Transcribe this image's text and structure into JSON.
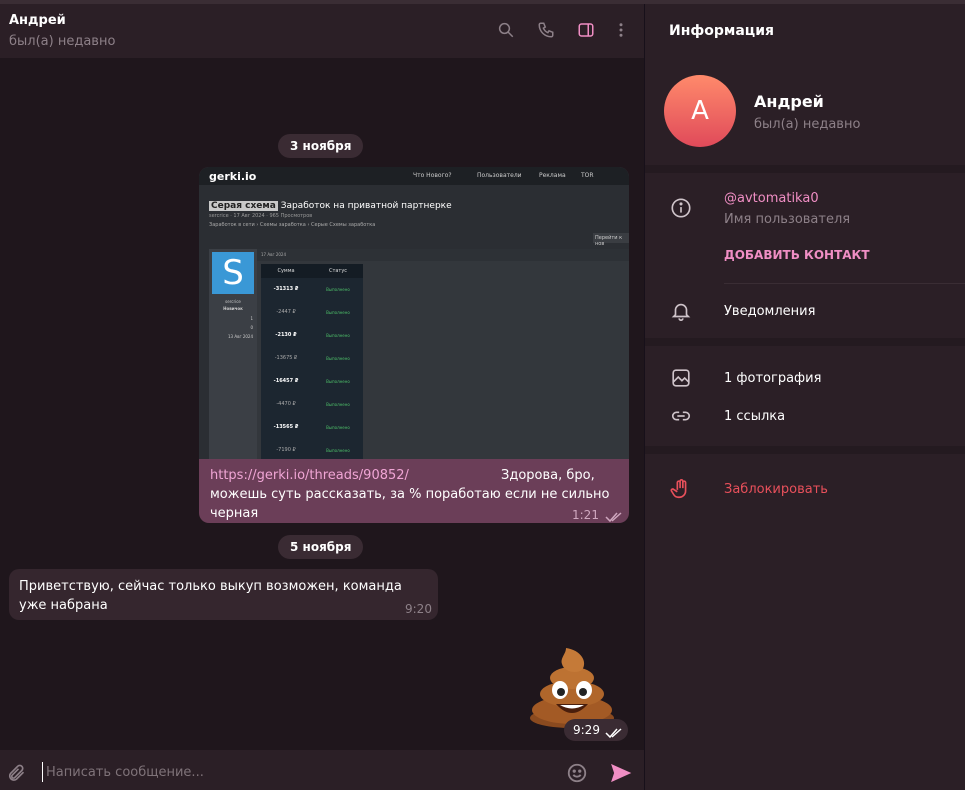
{
  "chat": {
    "name": "Андрей",
    "status": "был(а) недавно"
  },
  "dates": [
    "3 ноября",
    "5 ноября"
  ],
  "outgoing": {
    "link": "https://gerki.io/threads/90852/",
    "text_line1": "Здорова, бро,",
    "text_line2": "можешь суть рассказать, за % поработаю если не сильно черная",
    "time": "1:21"
  },
  "screenshot": {
    "logo": "gerki.io",
    "nav": [
      "Что Нового?",
      "Пользователи",
      "Реклама",
      "TOR"
    ],
    "tag": "Серая схема",
    "title": "Заработок на приватной партнерке",
    "meta": "sercrice · 17 Авг 2024 · 965 Просмотров",
    "crumbs": "Заработок в сети  ›  Схемы заработка  ›  Серые Схемы заработка",
    "button": "Перейти к нов",
    "avatar_letter": "S",
    "side_lines": [
      "sercrice",
      "Новичок",
      "1",
      "0",
      "13 Авг 2024"
    ],
    "post_date": "17 Авг 2024",
    "table_headers": [
      "Сумма",
      "Статус"
    ],
    "rows": [
      {
        "amount": "-31313 ₽",
        "status": "Выполнено"
      },
      {
        "amount": "-2447 ₽",
        "status": "Выполнено"
      },
      {
        "amount": "-2130 ₽",
        "status": "Выполнено"
      },
      {
        "amount": "-13675 ₽",
        "status": "Выполнено"
      },
      {
        "amount": "-16457 ₽",
        "status": "Выполнено"
      },
      {
        "amount": "-4470 ₽",
        "status": "Выполнено"
      },
      {
        "amount": "-13565 ₽",
        "status": "Выполнено"
      },
      {
        "amount": "-7190 ₽",
        "status": "Выполнено"
      }
    ]
  },
  "incoming": {
    "text": "Приветствую, сейчас только выкуп возможен, команда уже набрана",
    "time": "9:20"
  },
  "sticker": {
    "time": "9:29"
  },
  "composer": {
    "placeholder": "Написать сообщение..."
  },
  "sidebar": {
    "title": "Информация",
    "avatar_letter": "А",
    "name": "Андрей",
    "status": "был(а) недавно",
    "username": "@avtomatika0",
    "username_label": "Имя пользователя",
    "add_contact": "ДОБАВИТЬ КОНТАКТ",
    "notifications": "Уведомления",
    "photos": "1 фотография",
    "links": "1 ссылка",
    "block": "Заблокировать"
  },
  "colors": {
    "accent": "#f08ec4",
    "outgoing_bubble": "#6b3e58",
    "incoming_bubble": "#35262e",
    "danger": "#e8505b"
  }
}
